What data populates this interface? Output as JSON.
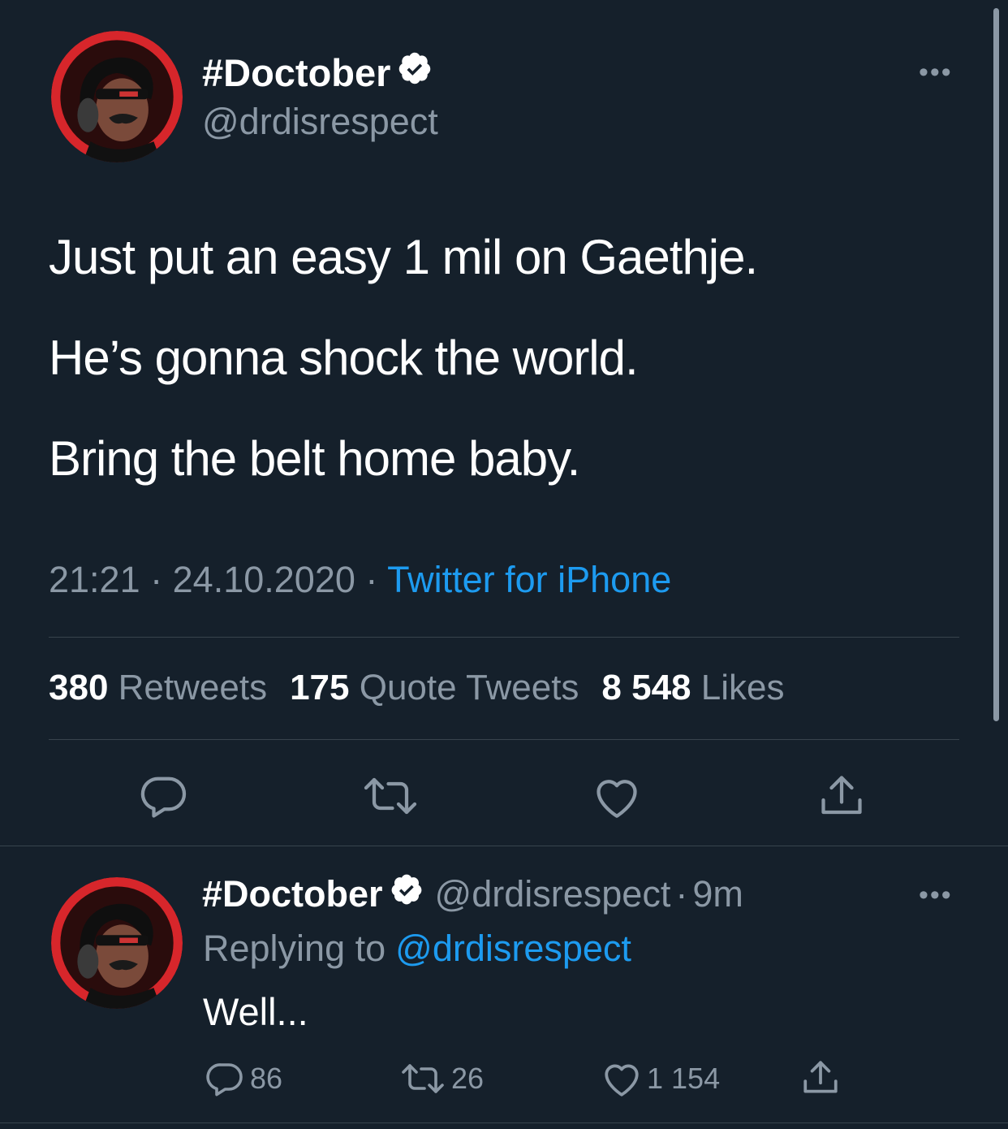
{
  "tweet": {
    "display_name": "#Doctober",
    "handle": "@drdisrespect",
    "lines": [
      "Just put an easy 1 mil on Gaethje.",
      "He’s gonna shock the world.",
      "Bring the belt home baby."
    ],
    "time": "21:21",
    "date": "24.10.2020",
    "dot": "·",
    "source": "Twitter for iPhone",
    "stats": {
      "retweets_count": "380",
      "retweets_label": "Retweets",
      "quotes_count": "175",
      "quotes_label": "Quote Tweets",
      "likes_count": "8 548",
      "likes_label": "Likes"
    }
  },
  "reply": {
    "display_name": "#Doctober",
    "handle": "@drdisrespect",
    "dot": "·",
    "age": "9m",
    "replying_label": "Replying to",
    "replying_handle": "@drdisrespect",
    "text": "Well...",
    "replies": "86",
    "retweets": "26",
    "likes": "1 154"
  },
  "more_glyph": "•••",
  "icons": [
    "verified-badge-icon",
    "reply-icon",
    "retweet-icon",
    "like-icon",
    "share-icon",
    "more-icon"
  ],
  "colors": {
    "background": "#15202b",
    "text": "#ffffff",
    "muted": "#8b98a5",
    "link": "#1d9bf0",
    "divider": "#38444d",
    "avatar_ring": "#d7262b"
  }
}
